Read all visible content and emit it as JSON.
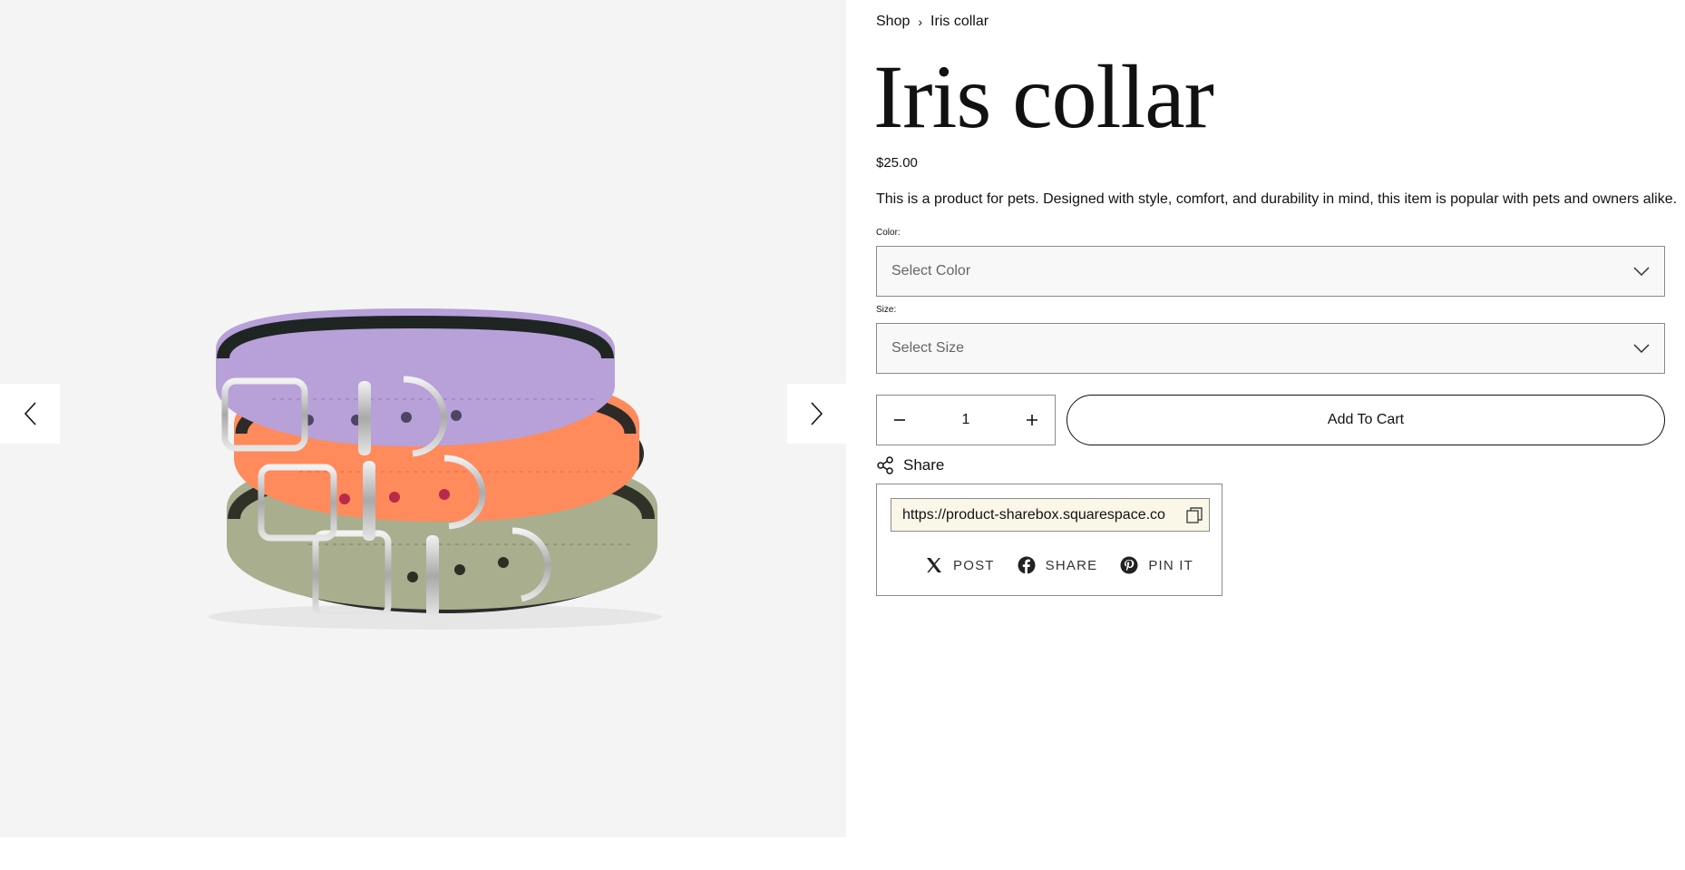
{
  "breadcrumb": {
    "shop": "Shop",
    "separator": "›",
    "current": "Iris collar"
  },
  "product": {
    "title": "Iris collar",
    "price": "$25.00",
    "description": "This is a product for pets. Designed with style, comfort, and durability in mind, this item is popular with pets and owners alike."
  },
  "options": {
    "color": {
      "label": "Color:",
      "placeholder": "Select Color"
    },
    "size": {
      "label": "Size:",
      "placeholder": "Select Size"
    }
  },
  "quantity": {
    "value": "1"
  },
  "cart": {
    "add_label": "Add To Cart"
  },
  "share": {
    "toggle_label": "Share",
    "url": "https://product-sharebox.squarespace.co",
    "links": [
      {
        "label": "POST",
        "icon": "x-icon"
      },
      {
        "label": "SHARE",
        "icon": "facebook-icon"
      },
      {
        "label": "PIN IT",
        "icon": "pinterest-icon"
      }
    ]
  },
  "gallery": {
    "image": "collar-stack-image",
    "colors": {
      "background": "#f4f4f4",
      "collar_top": "#b7a1d8",
      "collar_middle": "#ff8a5c",
      "collar_bottom": "#a9ae8f"
    }
  }
}
